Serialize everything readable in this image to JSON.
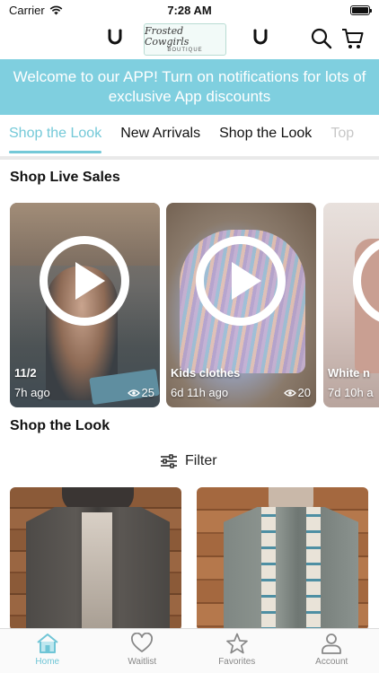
{
  "status_bar": {
    "carrier": "Carrier",
    "time": "7:28 AM"
  },
  "header": {
    "logo_line1": "Frosted Cowgirls",
    "logo_line2": "BOUTIQUE"
  },
  "banner": {
    "text": "Welcome to our APP!  Turn on notifications for lots of exclusive App discounts"
  },
  "tabs": [
    {
      "label": "Shop the Look",
      "active": true
    },
    {
      "label": "New Arrivals",
      "active": false
    },
    {
      "label": "Shop the Look",
      "active": false
    },
    {
      "label": "Top",
      "active": false
    }
  ],
  "live_sales": {
    "title": "Shop Live Sales",
    "cards": [
      {
        "label": "11/2",
        "time": "7h ago",
        "views": "25"
      },
      {
        "label": "Kids clothes",
        "time": "6d 11h ago",
        "views": "20"
      },
      {
        "label": "White n",
        "time": "7d 10h a"
      }
    ]
  },
  "shop_the_look": {
    "title": "Shop the Look",
    "filter_label": "Filter"
  },
  "tabbar": [
    {
      "label": "Home",
      "icon": "home-icon",
      "active": true
    },
    {
      "label": "Waitlist",
      "icon": "heart-icon",
      "active": false
    },
    {
      "label": "Favorites",
      "icon": "star-icon",
      "active": false
    },
    {
      "label": "Account",
      "icon": "person-icon",
      "active": false
    }
  ],
  "colors": {
    "accent": "#74c9d8",
    "banner": "#7fcfdf"
  }
}
